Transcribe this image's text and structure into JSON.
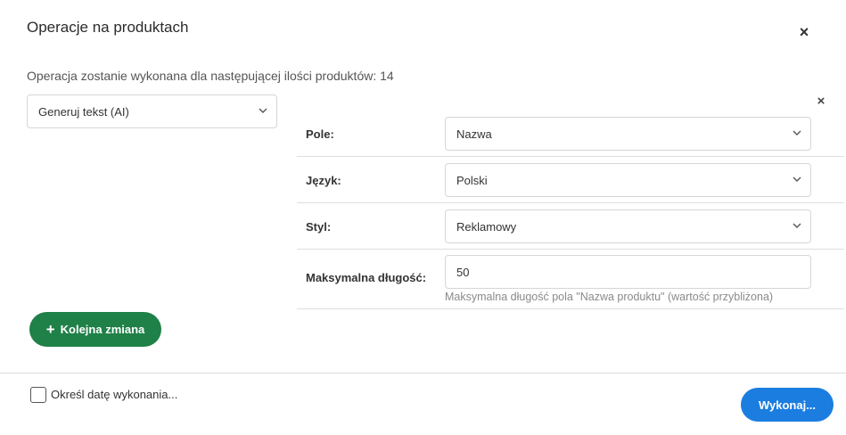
{
  "dialog": {
    "title": "Operacje na produktach",
    "close_symbol": "×",
    "info_text": "Operacja zostanie wykonana dla następującej ilości produktów: 14"
  },
  "operation_select": {
    "value": "Generuj tekst (AI)",
    "icon": "chevron-down-icon"
  },
  "operation_close_symbol": "×",
  "fields": {
    "field": {
      "label": "Pole:",
      "value": "Nazwa"
    },
    "language": {
      "label": "Język:",
      "value": "Polski"
    },
    "style": {
      "label": "Styl:",
      "value": "Reklamowy"
    },
    "max_length": {
      "label": "Maksymalna długość:",
      "value": "50",
      "hint": "Maksymalna długość pola \"Nazwa produktu\" (wartość przybliżona)"
    }
  },
  "buttons": {
    "add_change_plus": "+",
    "add_change": "Kolejna zmiana",
    "execute": "Wykonaj..."
  },
  "footer": {
    "schedule_checkbox_label": "Określ datę wykonania...",
    "schedule_checked": false
  },
  "colors": {
    "add_button": "#1f8048",
    "execute_button": "#1c7de0"
  }
}
